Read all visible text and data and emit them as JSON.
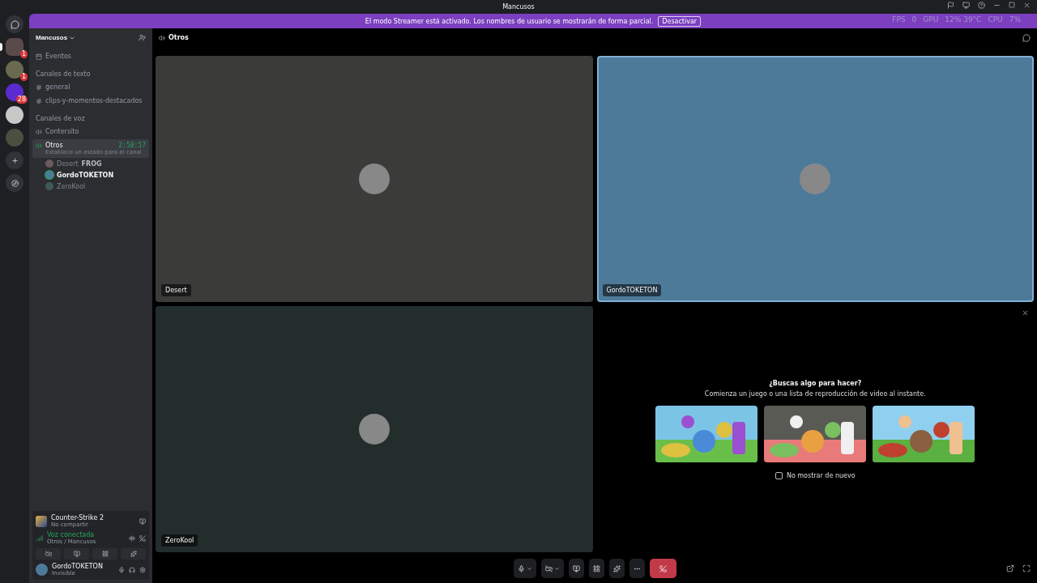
{
  "window": {
    "title": "Mancusos"
  },
  "overlay": {
    "fps_label": "FPS",
    "fps": "0",
    "gpu_label": "GPU",
    "gpu": "12% 39°C",
    "cpu_label": "CPU",
    "cpu": "7%"
  },
  "banner": {
    "text": "El modo Streamer está activado. Los nombres de usuario se mostrarán de forma parcial.",
    "button": "Desactivar"
  },
  "servers": [
    {
      "color": "#5a4a4a",
      "badge": "1",
      "selected": true
    },
    {
      "color": "#6a6a50",
      "badge": "1",
      "selected": false
    },
    {
      "color": "#5b2bd0",
      "badge": "28",
      "selected": false
    },
    {
      "color": "#c8c8c8",
      "selected": false
    },
    {
      "color": "#4a5040",
      "selected": false
    }
  ],
  "server": {
    "name": "Mancusos"
  },
  "channels": [
    {
      "kind": "events",
      "name": "Eventos"
    },
    {
      "kind": "category",
      "name": "Canales de texto"
    },
    {
      "kind": "text",
      "name": "general"
    },
    {
      "kind": "text",
      "name": "clips-y-momentos-destacados"
    },
    {
      "kind": "category",
      "name": "Canales de voz"
    },
    {
      "kind": "voice",
      "name": "Contersito",
      "selected": false
    },
    {
      "kind": "voice",
      "name": "Otros",
      "selected": true,
      "timer": "2:50:57",
      "status": "Establece un estado para el canal",
      "members": [
        {
          "name": "Desert",
          "tag": "FROG",
          "speaking": false,
          "color": "#6a5a5a"
        },
        {
          "name": "GordoTOKETON",
          "speaking": true,
          "color": "#4d7a9b"
        },
        {
          "name": "ZeroKool",
          "speaking": false,
          "color": "#3f5a58"
        }
      ]
    }
  ],
  "activity_status": {
    "game": "Counter-Strike 2",
    "sub": "No compartir"
  },
  "voice_status": {
    "title": "Voz conectada",
    "sub": "Otros / Mancusos"
  },
  "user": {
    "name": "GordoTOKETON",
    "status": "Invisible"
  },
  "header": {
    "channel": "Otros"
  },
  "tiles": [
    {
      "name": "Desert",
      "color": "#3b3b3a",
      "speaking": false
    },
    {
      "name": "GordoTOKETON",
      "color": "#4e7a9a",
      "speaking": true
    },
    {
      "name": "ZeroKool",
      "color": "#232e2c",
      "speaking": false
    }
  ],
  "activity_panel": {
    "title": "¿Buscas algo para hacer?",
    "subtitle": "Comienza un juego o una lista de reproducción de video al instante.",
    "checkbox": {
      "label": "No mostrar de nuevo",
      "checked": false
    }
  }
}
